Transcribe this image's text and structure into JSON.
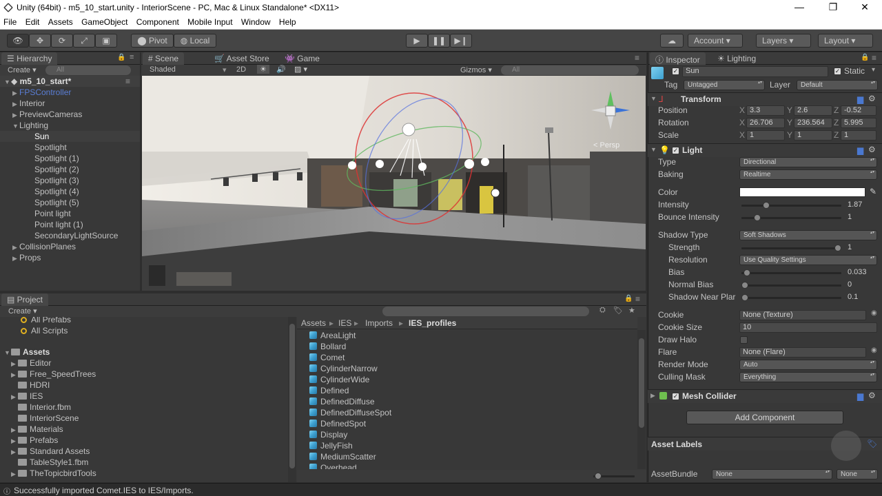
{
  "window": {
    "title": "Unity (64bit) - m5_10_start.unity - InteriorScene - PC, Mac & Linux Standalone* <DX11>",
    "minimize": "—",
    "maximize": "❐",
    "close": "✕"
  },
  "menu": [
    "File",
    "Edit",
    "Assets",
    "GameObject",
    "Component",
    "Mobile Input",
    "Window",
    "Help"
  ],
  "toolbar": {
    "pivot": "Pivot",
    "local": "Local",
    "account": "Account",
    "layers": "Layers",
    "layout": "Layout"
  },
  "hierarchy": {
    "tab": "Hierarchy",
    "create": "Create",
    "search_placeholder": "All",
    "scene": "m5_10_start*",
    "items": [
      {
        "label": "FPSController",
        "indent": 0,
        "expand": "▶",
        "color": "#5a7ed6"
      },
      {
        "label": "Interior",
        "indent": 0,
        "expand": "▶"
      },
      {
        "label": "PreviewCameras",
        "indent": 0,
        "expand": "▶"
      },
      {
        "label": "Lighting",
        "indent": 0,
        "expand": "▼"
      },
      {
        "label": "Sun",
        "indent": 1,
        "selected": true
      },
      {
        "label": "Spotlight",
        "indent": 1
      },
      {
        "label": "Spotlight (1)",
        "indent": 1
      },
      {
        "label": "Spotlight (2)",
        "indent": 1
      },
      {
        "label": "Spotlight (3)",
        "indent": 1
      },
      {
        "label": "Spotlight (4)",
        "indent": 1
      },
      {
        "label": "Spotlight (5)",
        "indent": 1
      },
      {
        "label": "Point light",
        "indent": 1
      },
      {
        "label": "Point light (1)",
        "indent": 1
      },
      {
        "label": "SecondaryLightSource",
        "indent": 1
      },
      {
        "label": "CollisionPlanes",
        "indent": 0,
        "expand": "▶"
      },
      {
        "label": "Props",
        "indent": 0,
        "expand": "▶"
      }
    ]
  },
  "scene_view": {
    "tabs": [
      "Scene",
      "Asset Store",
      "Game"
    ],
    "shading": "Shaded",
    "mode_2d": "2D",
    "gizmos": "Gizmos",
    "search_placeholder": "All",
    "persp_label": "Persp"
  },
  "project": {
    "tab": "Project",
    "create": "Create",
    "favorites": [
      "All Prefabs",
      "All Scripts"
    ],
    "assets_root": "Assets",
    "folders": [
      {
        "label": "Editor",
        "expand": "▶"
      },
      {
        "label": "Free_SpeedTrees",
        "expand": "▶"
      },
      {
        "label": "HDRI",
        "expand": ""
      },
      {
        "label": "IES",
        "expand": "▶"
      },
      {
        "label": "Interior.fbm",
        "expand": ""
      },
      {
        "label": "InteriorScene",
        "expand": ""
      },
      {
        "label": "Materials",
        "expand": "▶"
      },
      {
        "label": "Prefabs",
        "expand": "▶"
      },
      {
        "label": "Standard Assets",
        "expand": "▶"
      },
      {
        "label": "TableStyle1.fbm",
        "expand": ""
      },
      {
        "label": "TheTopicbirdTools",
        "expand": "▶"
      }
    ],
    "breadcrumb": [
      "Assets",
      "IES",
      "Imports",
      "IES_profiles"
    ],
    "files": [
      "AreaLight",
      "Bollard",
      "Comet",
      "CylinderNarrow",
      "CylinderWide",
      "Defined",
      "DefinedDiffuse",
      "DefinedDiffuseSpot",
      "DefinedSpot",
      "Display",
      "JellyFish",
      "MediumScatter",
      "Overhead"
    ]
  },
  "inspector": {
    "tabs": [
      "Inspector",
      "Lighting"
    ],
    "object_name": "Sun",
    "static_label": "Static",
    "tag_label": "Tag",
    "tag_value": "Untagged",
    "layer_label": "Layer",
    "layer_value": "Default",
    "transform": {
      "title": "Transform",
      "position": {
        "label": "Position",
        "x": "3.3",
        "y": "2.6",
        "z": "-0.52"
      },
      "rotation": {
        "label": "Rotation",
        "x": "26.706",
        "y": "236.564",
        "z": "5.995"
      },
      "scale": {
        "label": "Scale",
        "x": "1",
        "y": "1",
        "z": "1"
      }
    },
    "light": {
      "title": "Light",
      "type_label": "Type",
      "type_value": "Directional",
      "baking_label": "Baking",
      "baking_value": "Realtime",
      "color_label": "Color",
      "color_value": "#ffffff",
      "intensity_label": "Intensity",
      "intensity_value": "1.87",
      "intensity_fraction": 0.23,
      "bounce_label": "Bounce Intensity",
      "bounce_value": "1",
      "bounce_fraction": 0.13,
      "shadow_type_label": "Shadow Type",
      "shadow_type_value": "Soft Shadows",
      "strength_label": "Strength",
      "strength_value": "1",
      "strength_fraction": 1.0,
      "resolution_label": "Resolution",
      "resolution_value": "Use Quality Settings",
      "bias_label": "Bias",
      "bias_value": "0.033",
      "bias_fraction": 0.02,
      "normal_bias_label": "Normal Bias",
      "normal_bias_value": "0",
      "normal_bias_fraction": 0.0,
      "near_plane_label": "Shadow Near Plar",
      "near_plane_value": "0.1",
      "near_plane_fraction": 0.0,
      "cookie_label": "Cookie",
      "cookie_value": "None (Texture)",
      "cookie_size_label": "Cookie Size",
      "cookie_size_value": "10",
      "draw_halo_label": "Draw Halo",
      "flare_label": "Flare",
      "flare_value": "None (Flare)",
      "render_mode_label": "Render Mode",
      "render_mode_value": "Auto",
      "culling_label": "Culling Mask",
      "culling_value": "Everything"
    },
    "mesh_collider": {
      "title": "Mesh Collider"
    },
    "add_component": "Add Component",
    "asset_labels": "Asset Labels",
    "asset_bundle_label": "AssetBundle",
    "asset_bundle_value": "None",
    "asset_bundle_variant": "None"
  },
  "status_bar": {
    "message": "Successfully imported Comet.IES to IES/Imports."
  },
  "colors": {
    "accent": "#3a72d8",
    "panel": "#383838",
    "selected": "#3e3e3e"
  }
}
